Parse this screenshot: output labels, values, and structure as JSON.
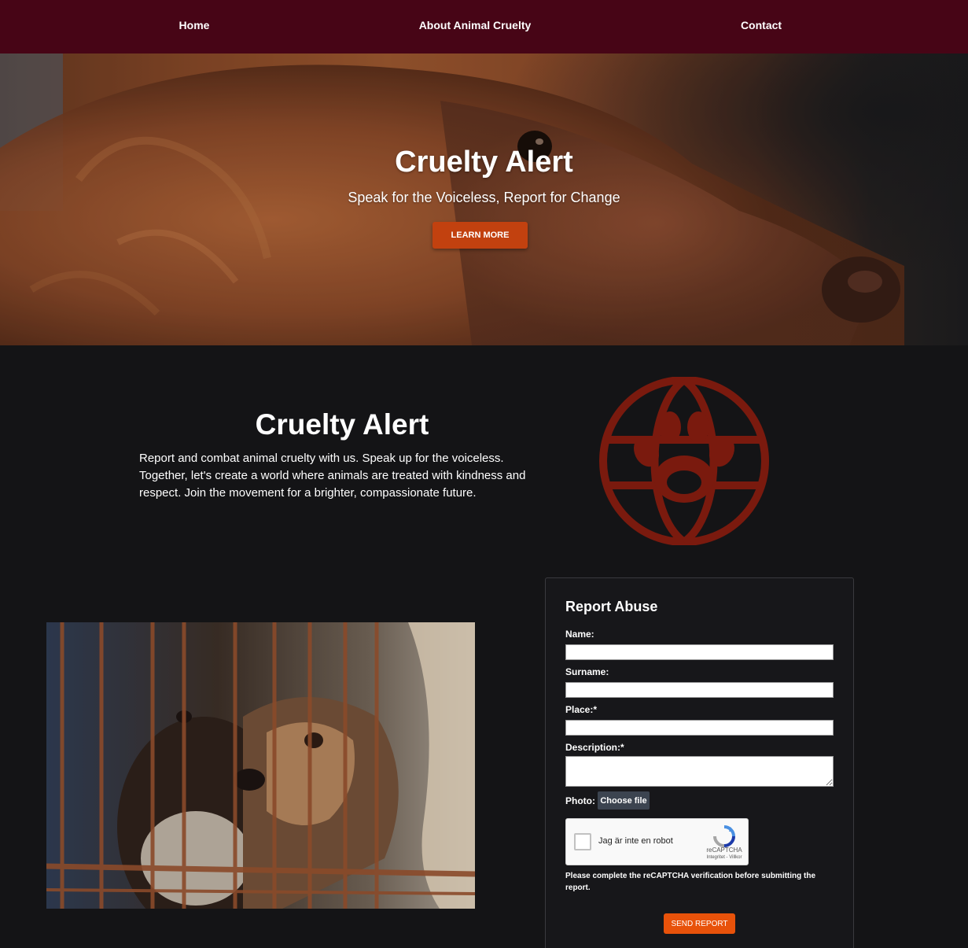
{
  "nav": {
    "home": "Home",
    "about": "About Animal Cruelty",
    "contact": "Contact"
  },
  "hero": {
    "title": "Cruelty Alert",
    "subtitle": "Speak for the Voiceless, Report for Change",
    "button": "LEARN MORE"
  },
  "about": {
    "title": "Cruelty Alert",
    "text": "Report and combat animal cruelty with us. Speak up for the voiceless. Together, let's create a world where animals are treated with kindness and respect. Join the movement for a brighter, compassionate future."
  },
  "form": {
    "title": "Report Abuse",
    "name_label": "Name:",
    "surname_label": "Surname:",
    "place_label": "Place:*",
    "description_label": "Description:*",
    "photo_label": "Photo:",
    "file_button": "Choose file",
    "captcha_label": "Jag är inte en robot",
    "captcha_brand": "reCAPTCHA",
    "captcha_links": "Integritet - Villkor",
    "warning": "Please complete the reCAPTCHA verification before submitting the report.",
    "submit": "SEND REPORT"
  },
  "colors": {
    "nav_bg": "#470516",
    "accent_orange": "#e8520a",
    "logo_red": "#7a1a0e",
    "page_bg": "#141416"
  }
}
